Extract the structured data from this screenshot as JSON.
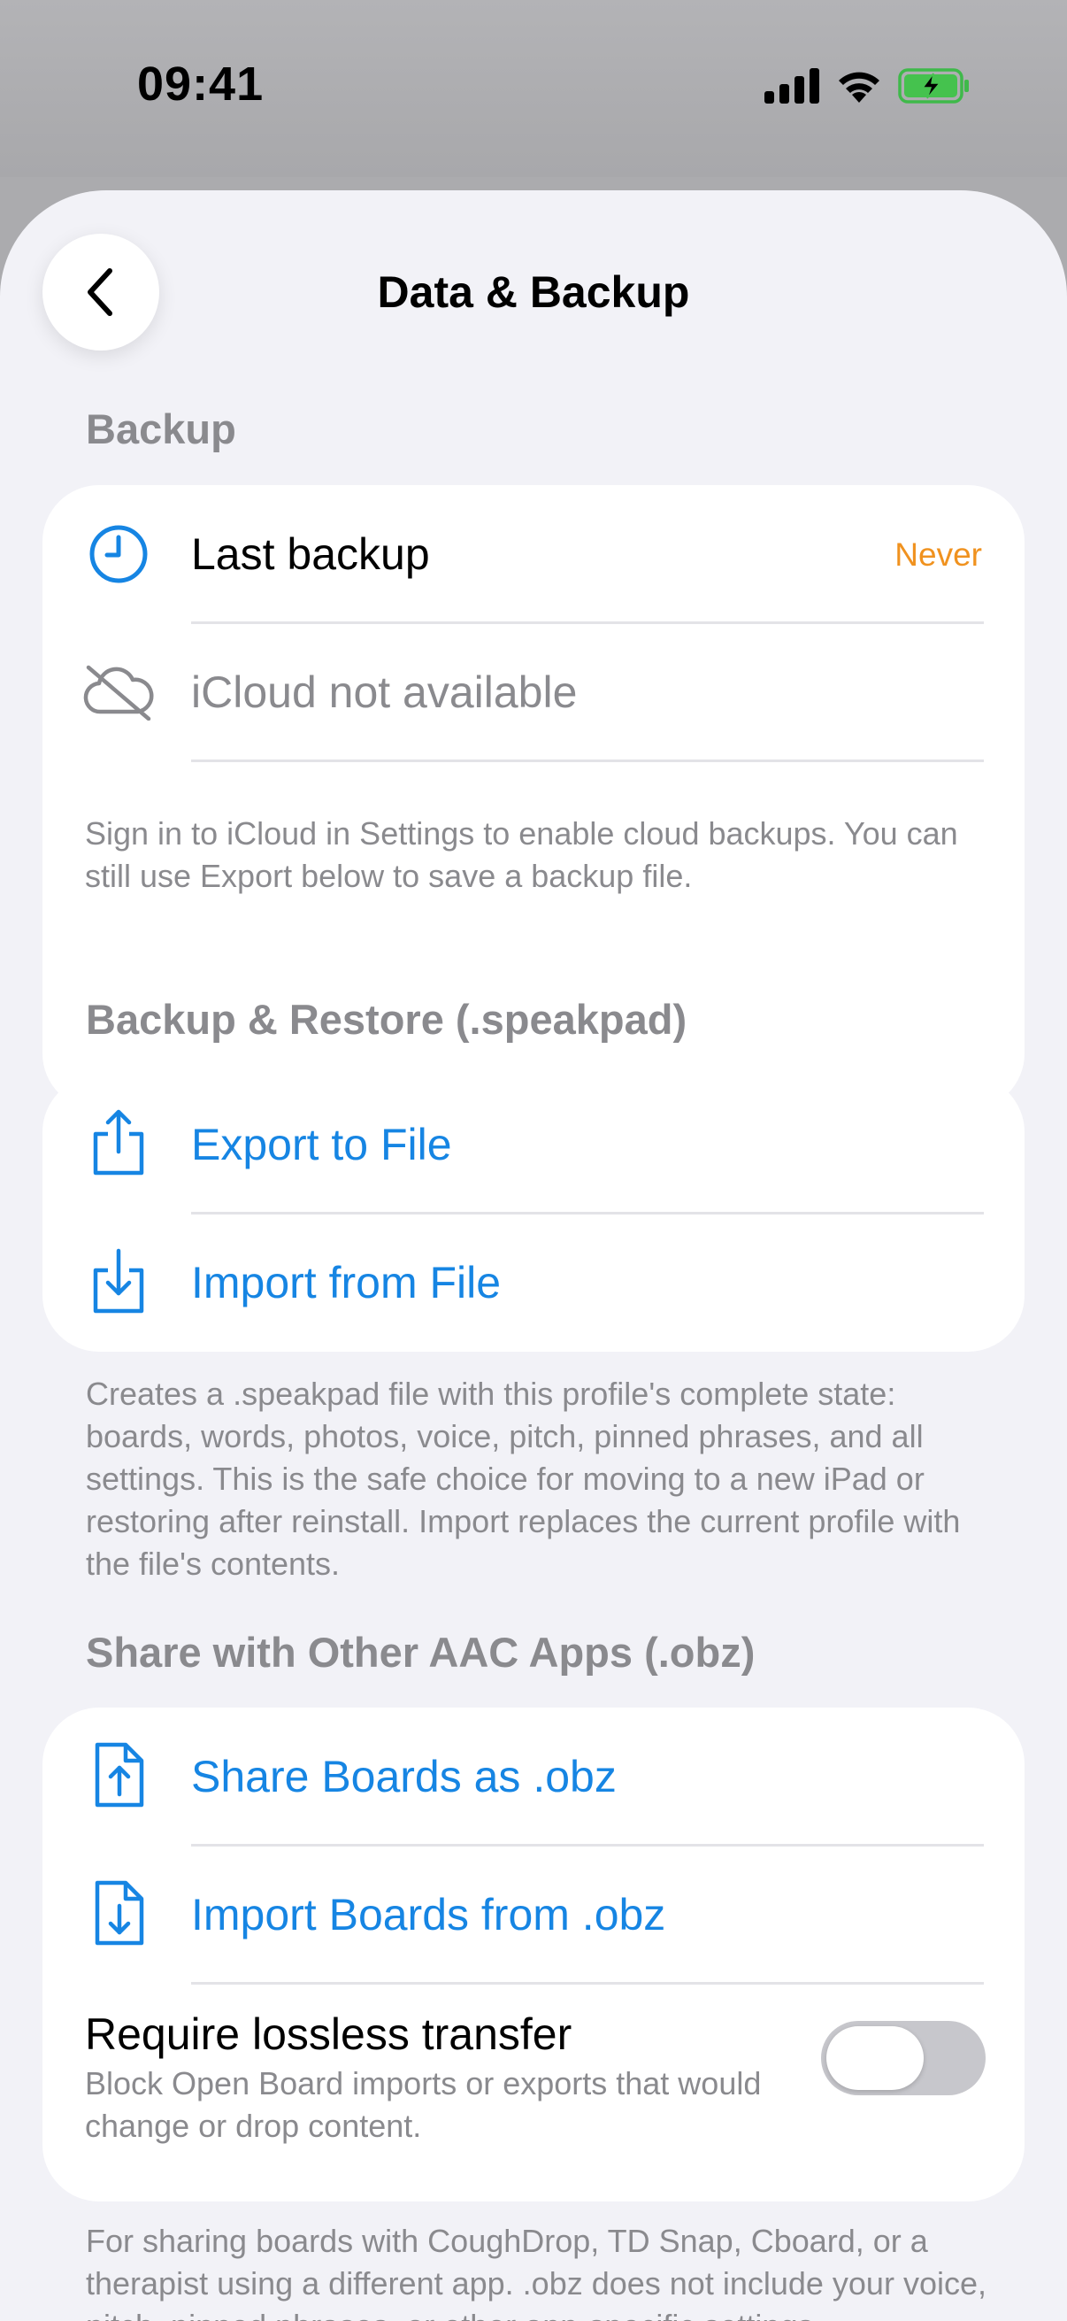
{
  "status": {
    "time": "09:41"
  },
  "nav": {
    "title": "Data & Backup",
    "back_icon": "chevron-left-icon"
  },
  "backup": {
    "header": "Backup",
    "last_backup_label": "Last backup",
    "last_backup_value": "Never",
    "icloud_label": "iCloud not available",
    "note": "Sign in to iCloud in Settings to enable cloud backups. You can still use Export below to save a backup file."
  },
  "restore": {
    "header": "Backup & Restore (.speakpad)",
    "export_label": "Export to File",
    "import_label": "Import from File",
    "footnote": "Creates a .speakpad file with this profile's complete state: boards, words, photos, voice, pitch, pinned phrases, and all settings. This is the safe choice for moving to a new iPad or restoring after reinstall. Import replaces the current profile with the file's contents."
  },
  "obz": {
    "header": "Share with Other AAC Apps (.obz)",
    "share_label": "Share Boards as .obz",
    "import_label": "Import Boards from .obz",
    "lossless_title": "Require lossless transfer",
    "lossless_subtitle": "Block Open Board imports or exports that would change or drop content.",
    "lossless_on": false,
    "footnote": "For sharing boards with CoughDrop, TD Snap, Cboard, or a therapist using a different app. .obz does not include your voice, pitch, pinned phrases, or other app-specific settings."
  },
  "colors": {
    "accent": "#1685e3",
    "warning": "#f0921f",
    "secondary_text": "#8a8a8e",
    "background": "#f2f2f7"
  }
}
